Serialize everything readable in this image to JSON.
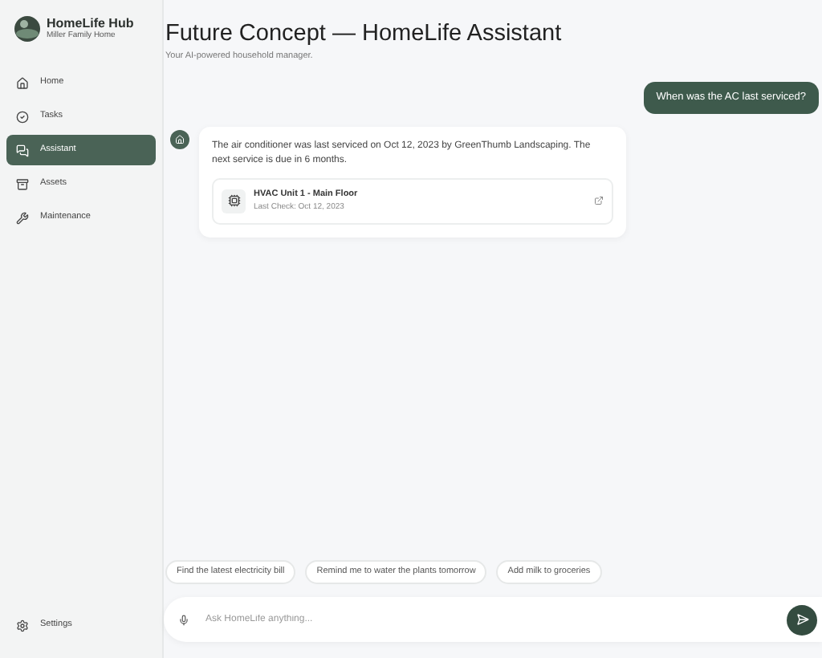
{
  "sidebar": {
    "brand": {
      "title": "HomeLife Hub",
      "subtitle": "Miller Family Home"
    },
    "items": [
      {
        "label": "Home",
        "selected": false
      },
      {
        "label": "Tasks",
        "selected": false
      },
      {
        "label": "Assistant",
        "selected": true
      },
      {
        "label": "Assets",
        "selected": false
      },
      {
        "label": "Maintenance",
        "selected": false
      }
    ],
    "footer": {
      "label": "Settings"
    }
  },
  "header": {
    "title": "Future Concept — HomeLife Assistant",
    "subtitle": "Your AI-powered household manager."
  },
  "messages": [
    {
      "kind": "user",
      "text": "When was the AC last serviced?"
    },
    {
      "kind": "assistant",
      "text": "The air conditioner was last serviced on Oct 12, 2023 by GreenThumb Landscaping. The next service is due in 6 months.",
      "attachment": {
        "title": "HVAC Unit 1 - Main Floor",
        "subtitle": "Last Check: Oct 12, 2023"
      }
    }
  ],
  "suggestions": [
    "Find the latest electricity bill",
    "Remind me to water the plants tomorrow",
    "Add milk to groceries"
  ],
  "composer": {
    "placeholder": "Ask HomeLife anything..."
  }
}
